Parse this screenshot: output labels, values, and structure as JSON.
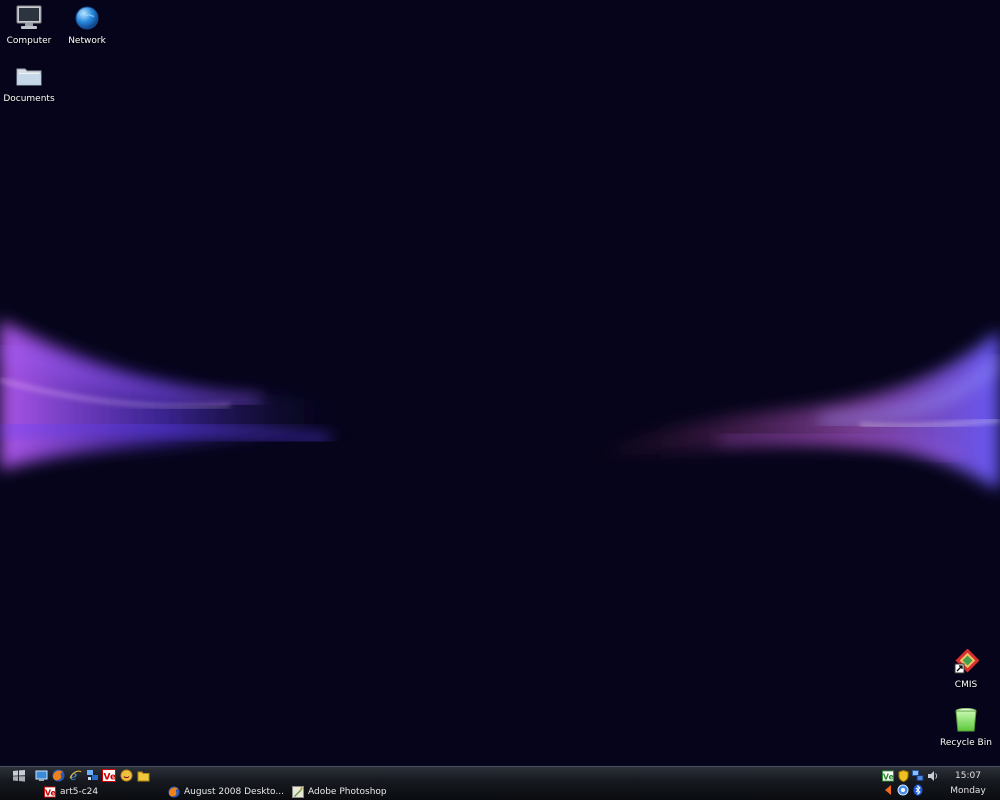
{
  "desktop": {
    "icons_top": [
      {
        "label": "Computer",
        "icon": "computer-icon"
      },
      {
        "label": "Network",
        "icon": "network-globe-icon"
      },
      {
        "label": "Documents",
        "icon": "folder-icon"
      }
    ],
    "icons_bottom": [
      {
        "label": "CMIS",
        "icon": "cmis-shortcut-icon"
      },
      {
        "label": "Recycle Bin",
        "icon": "recycle-bin-icon"
      }
    ]
  },
  "taskbar": {
    "start_icon": "windows-logo-icon",
    "quick_launch": [
      "show-desktop-icon",
      "firefox-icon",
      "internet-explorer-icon",
      "network-app-icon",
      "ve-app-icon",
      "messenger-icon",
      "folder-icon"
    ],
    "tasks": [
      {
        "label": "art5-c24",
        "icon": "ve-app-icon"
      },
      {
        "label": "August 2008 Deskto...",
        "icon": "firefox-icon"
      },
      {
        "label": "Adobe Photoshop",
        "icon": "photoshop-icon"
      }
    ],
    "tray_row1": [
      "ve-tray-icon",
      "shield-icon",
      "network-tray-icon",
      "volume-icon"
    ],
    "tray_row2": [
      "arrow-icon",
      "settings-tray-icon",
      "bluetooth-icon"
    ],
    "clock": {
      "time": "15:07",
      "day": "Monday"
    }
  },
  "colors": {
    "desktop_bg": "#05041a",
    "swirl_purple": "#b04cff",
    "swirl_blue": "#4a4cff",
    "taskbar_bg": "#15181e"
  }
}
